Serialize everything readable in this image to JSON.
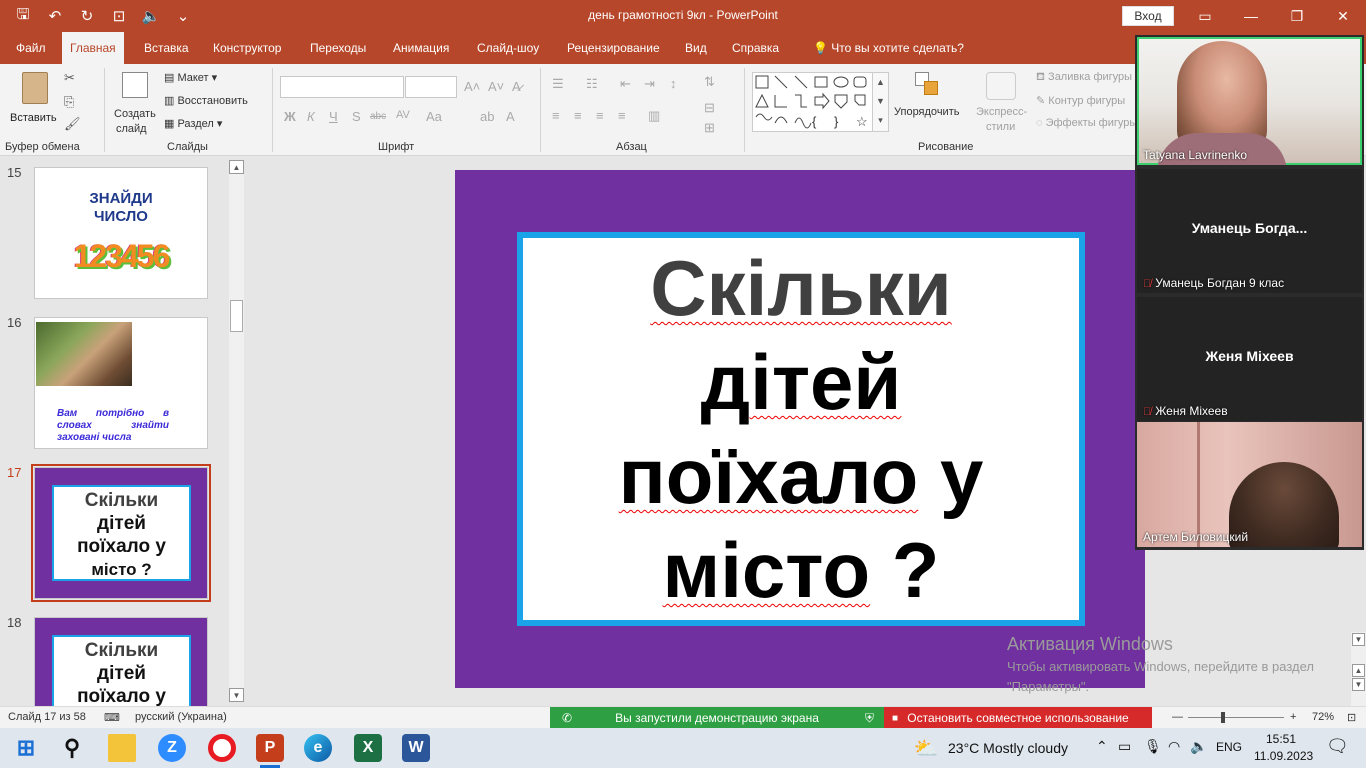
{
  "titlebar": {
    "doc_title": "день грамотності 9кл  -  PowerPoint",
    "login": "Вход",
    "qat_icons": [
      "save-icon",
      "undo-icon",
      "redo-icon",
      "slideshow-icon",
      "speaker-icon",
      "customize-icon"
    ],
    "qat_glyphs": [
      "🖫",
      "↶",
      "↻",
      "⊡",
      "🔈",
      "⌄"
    ]
  },
  "tabs": [
    "Файл",
    "Главная",
    "Вставка",
    "Конструктор",
    "Переходы",
    "Анимация",
    "Слайд-шоу",
    "Рецензирование",
    "Вид",
    "Справка",
    "Что вы хотите сделать?"
  ],
  "ribbon": {
    "clipboard": {
      "paste": "Вставить",
      "group": "Буфер обмена"
    },
    "slides": {
      "new_slide_1": "Создать",
      "new_slide_2": "слайд",
      "layout": "Макет",
      "reset": "Восстановить",
      "section": "Раздел",
      "group": "Слайды"
    },
    "font": {
      "group": "Шрифт",
      "bold": "Ж",
      "italic": "К",
      "underline": "Ч",
      "shadow": "S",
      "strike": "abc",
      "spacing": "AV",
      "case": "Aa",
      "color": "A"
    },
    "paragraph": {
      "group": "Абзац"
    },
    "drawing": {
      "arrange": "Упорядочить",
      "quick_styles_1": "Экспресс-",
      "quick_styles_2": "стили",
      "fill": "Заливка фигуры",
      "outline": "Контур фигуры",
      "effects": "Эффекты фигуры",
      "group": "Рисование"
    }
  },
  "slides_panel": {
    "items": [
      {
        "num": "15",
        "title_1": "ЗНАЙДИ",
        "title_2": "ЧИСЛО",
        "digits": "123456"
      },
      {
        "num": "16",
        "text": "Вам потрібно в словах знайти заховані числа"
      },
      {
        "num": "17",
        "l1": "Скільки",
        "l2": "дітей",
        "l3": "поїхало у",
        "l4": "місто ?"
      },
      {
        "num": "18",
        "l1": "Скільки",
        "l2": "дітей",
        "l3": "поїхало у"
      }
    ]
  },
  "slide": {
    "line1": "Скільки",
    "line2": "дітей",
    "line3a": "поїхало",
    "line3b": "у",
    "line4a": "місто",
    "line4b": "?"
  },
  "watermark": {
    "title": "Активация Windows",
    "text": "Чтобы активировать Windows, перейдите в раздел \"Параметры\"."
  },
  "participants": [
    {
      "name": "Tatyana Lavrinenko"
    },
    {
      "display": "Уманець  Богда...",
      "name": "Уманець Богдан 9 клас"
    },
    {
      "display": "Женя Міхеев",
      "name": "Женя Міхеев"
    },
    {
      "name": "Артем Биловицкий"
    }
  ],
  "statusbar": {
    "slide_info": "Слайд 17 из 58",
    "language": "русский (Украина)",
    "share_running": "Вы запустили демонстрацию экрана",
    "stop_share": "Остановить совместное использование",
    "zoom": "72%"
  },
  "taskbar": {
    "weather": "23°C  Mostly cloudy",
    "lang": "ENG",
    "time": "15:51",
    "date": "11.09.2023"
  },
  "colors": {
    "accent": "#b7472a",
    "slide_bg": "#7030a0",
    "box_border": "#1aa3e8",
    "share_green": "#2ea043",
    "share_red": "#d62a2a"
  }
}
